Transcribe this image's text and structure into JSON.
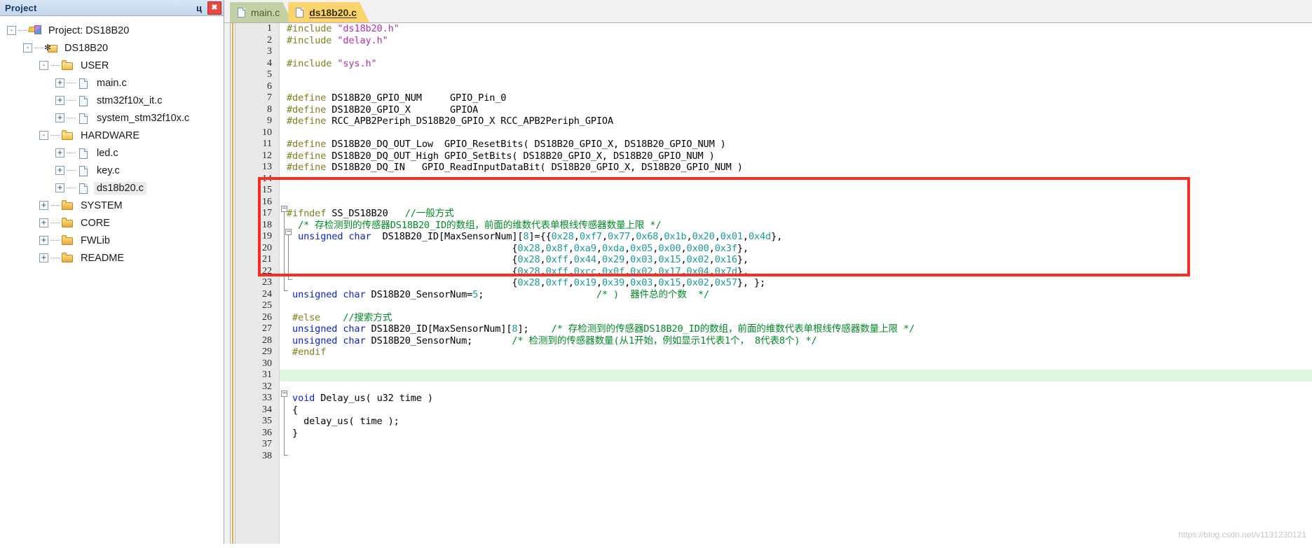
{
  "panel": {
    "title": "Project",
    "pin_icon": "pushpin-icon",
    "pin_glyph": "ц",
    "close_glyph": "✖",
    "tree": [
      {
        "label": "Project: DS18B20",
        "depth": 0,
        "expander": "-",
        "icon": "project-icon",
        "selected": false
      },
      {
        "label": "DS18B20",
        "depth": 1,
        "expander": "-",
        "icon": "target-icon",
        "selected": false
      },
      {
        "label": "USER",
        "depth": 2,
        "expander": "-",
        "icon": "folder-open-icon",
        "selected": false
      },
      {
        "label": "main.c",
        "depth": 3,
        "expander": "+",
        "icon": "file-icon",
        "selected": false
      },
      {
        "label": "stm32f10x_it.c",
        "depth": 3,
        "expander": "+",
        "icon": "file-icon",
        "selected": false
      },
      {
        "label": "system_stm32f10x.c",
        "depth": 3,
        "expander": "+",
        "icon": "file-icon",
        "selected": false
      },
      {
        "label": "HARDWARE",
        "depth": 2,
        "expander": "-",
        "icon": "folder-open-icon",
        "selected": false
      },
      {
        "label": "led.c",
        "depth": 3,
        "expander": "+",
        "icon": "file-icon",
        "selected": false
      },
      {
        "label": "key.c",
        "depth": 3,
        "expander": "+",
        "icon": "file-icon",
        "selected": false
      },
      {
        "label": "ds18b20.c",
        "depth": 3,
        "expander": "+",
        "icon": "file-icon",
        "selected": true
      },
      {
        "label": "SYSTEM",
        "depth": 2,
        "expander": "+",
        "icon": "folder-icon",
        "selected": false
      },
      {
        "label": "CORE",
        "depth": 2,
        "expander": "+",
        "icon": "folder-icon",
        "selected": false
      },
      {
        "label": "FWLib",
        "depth": 2,
        "expander": "+",
        "icon": "folder-icon",
        "selected": false
      },
      {
        "label": "README",
        "depth": 2,
        "expander": "+",
        "icon": "folder-icon",
        "selected": false
      }
    ]
  },
  "editor": {
    "tabs": [
      {
        "label": "main.c",
        "active": false
      },
      {
        "label": "ds18b20.c",
        "active": true
      }
    ],
    "first_line": 1,
    "last_line": 38,
    "highlight_line": 31,
    "lines": [
      {
        "n": 1,
        "spans": [
          {
            "t": "#include ",
            "c": "k-pre"
          },
          {
            "t": "\"ds18b20.h\"",
            "c": "k-str"
          }
        ]
      },
      {
        "n": 2,
        "spans": [
          {
            "t": "#include ",
            "c": "k-pre"
          },
          {
            "t": "\"delay.h\"",
            "c": "k-str"
          }
        ]
      },
      {
        "n": 3,
        "spans": []
      },
      {
        "n": 4,
        "spans": [
          {
            "t": "#include ",
            "c": "k-pre"
          },
          {
            "t": "\"sys.h\"",
            "c": "k-str"
          }
        ]
      },
      {
        "n": 5,
        "spans": []
      },
      {
        "n": 6,
        "spans": []
      },
      {
        "n": 7,
        "spans": [
          {
            "t": "#define ",
            "c": "k-pre"
          },
          {
            "t": "DS18B20_GPIO_NUM     GPIO_Pin_0",
            "c": "k-plain"
          }
        ]
      },
      {
        "n": 8,
        "spans": [
          {
            "t": "#define ",
            "c": "k-pre"
          },
          {
            "t": "DS18B20_GPIO_X       GPIOA",
            "c": "k-plain"
          }
        ]
      },
      {
        "n": 9,
        "spans": [
          {
            "t": "#define ",
            "c": "k-pre"
          },
          {
            "t": "RCC_APB2Periph_DS18B20_GPIO_X RCC_APB2Periph_GPIOA",
            "c": "k-plain"
          }
        ]
      },
      {
        "n": 10,
        "spans": []
      },
      {
        "n": 11,
        "spans": [
          {
            "t": "#define ",
            "c": "k-pre"
          },
          {
            "t": "DS18B20_DQ_OUT_Low  GPIO_ResetBits( DS18B20_GPIO_X, DS18B20_GPIO_NUM )",
            "c": "k-plain"
          }
        ]
      },
      {
        "n": 12,
        "spans": [
          {
            "t": "#define ",
            "c": "k-pre"
          },
          {
            "t": "DS18B20_DQ_OUT_High GPIO_SetBits( DS18B20_GPIO_X, DS18B20_GPIO_NUM )",
            "c": "k-plain"
          }
        ]
      },
      {
        "n": 13,
        "spans": [
          {
            "t": "#define ",
            "c": "k-pre"
          },
          {
            "t": "DS18B20_DQ_IN   GPIO_ReadInputDataBit( DS18B20_GPIO_X, DS18B20_GPIO_NUM )",
            "c": "k-plain"
          }
        ]
      },
      {
        "n": 14,
        "spans": []
      },
      {
        "n": 15,
        "spans": []
      },
      {
        "n": 16,
        "spans": []
      },
      {
        "n": 17,
        "spans": [
          {
            "t": "#ifndef ",
            "c": "k-pre"
          },
          {
            "t": "SS_DS18B20   ",
            "c": "k-plain"
          },
          {
            "t": "//一般方式",
            "c": "k-cmt"
          }
        ]
      },
      {
        "n": 18,
        "spans": [
          {
            "t": "  /* 存检测到的传感器DS18B20_ID的数组，前面的维数代表单根线传感器数量上限 */",
            "c": "k-cmt"
          }
        ]
      },
      {
        "n": 19,
        "spans": [
          {
            "t": "  ",
            "c": "k-plain"
          },
          {
            "t": "unsigned char",
            "c": "k-key"
          },
          {
            "t": "  DS18B20_ID[MaxSensorNum][",
            "c": "k-plain"
          },
          {
            "t": "8",
            "c": "k-num"
          },
          {
            "t": "]={{",
            "c": "k-plain"
          },
          {
            "t": "0x28",
            "c": "k-num"
          },
          {
            "t": ",",
            "c": "k-plain"
          },
          {
            "t": "0xf7",
            "c": "k-num"
          },
          {
            "t": ",",
            "c": "k-plain"
          },
          {
            "t": "0x77",
            "c": "k-num"
          },
          {
            "t": ",",
            "c": "k-plain"
          },
          {
            "t": "0x68",
            "c": "k-num"
          },
          {
            "t": ",",
            "c": "k-plain"
          },
          {
            "t": "0x1b",
            "c": "k-num"
          },
          {
            "t": ",",
            "c": "k-plain"
          },
          {
            "t": "0x20",
            "c": "k-num"
          },
          {
            "t": ",",
            "c": "k-plain"
          },
          {
            "t": "0x01",
            "c": "k-num"
          },
          {
            "t": ",",
            "c": "k-plain"
          },
          {
            "t": "0x4d",
            "c": "k-num"
          },
          {
            "t": "},",
            "c": "k-plain"
          }
        ]
      },
      {
        "n": 20,
        "spans": [
          {
            "t": "                                        {",
            "c": "k-plain"
          },
          {
            "t": "0x28",
            "c": "k-num"
          },
          {
            "t": ",",
            "c": "k-plain"
          },
          {
            "t": "0x8f",
            "c": "k-num"
          },
          {
            "t": ",",
            "c": "k-plain"
          },
          {
            "t": "0xa9",
            "c": "k-num"
          },
          {
            "t": ",",
            "c": "k-plain"
          },
          {
            "t": "0xda",
            "c": "k-num"
          },
          {
            "t": ",",
            "c": "k-plain"
          },
          {
            "t": "0x05",
            "c": "k-num"
          },
          {
            "t": ",",
            "c": "k-plain"
          },
          {
            "t": "0x00",
            "c": "k-num"
          },
          {
            "t": ",",
            "c": "k-plain"
          },
          {
            "t": "0x00",
            "c": "k-num"
          },
          {
            "t": ",",
            "c": "k-plain"
          },
          {
            "t": "0x3f",
            "c": "k-num"
          },
          {
            "t": "},",
            "c": "k-plain"
          }
        ]
      },
      {
        "n": 21,
        "spans": [
          {
            "t": "                                        {",
            "c": "k-plain"
          },
          {
            "t": "0x28",
            "c": "k-num"
          },
          {
            "t": ",",
            "c": "k-plain"
          },
          {
            "t": "0xff",
            "c": "k-num"
          },
          {
            "t": ",",
            "c": "k-plain"
          },
          {
            "t": "0x44",
            "c": "k-num"
          },
          {
            "t": ",",
            "c": "k-plain"
          },
          {
            "t": "0x29",
            "c": "k-num"
          },
          {
            "t": ",",
            "c": "k-plain"
          },
          {
            "t": "0x03",
            "c": "k-num"
          },
          {
            "t": ",",
            "c": "k-plain"
          },
          {
            "t": "0x15",
            "c": "k-num"
          },
          {
            "t": ",",
            "c": "k-plain"
          },
          {
            "t": "0x02",
            "c": "k-num"
          },
          {
            "t": ",",
            "c": "k-plain"
          },
          {
            "t": "0x16",
            "c": "k-num"
          },
          {
            "t": "},",
            "c": "k-plain"
          }
        ]
      },
      {
        "n": 22,
        "spans": [
          {
            "t": "                                        {",
            "c": "k-plain"
          },
          {
            "t": "0x28",
            "c": "k-num"
          },
          {
            "t": ",",
            "c": "k-plain"
          },
          {
            "t": "0xff",
            "c": "k-num"
          },
          {
            "t": ",",
            "c": "k-plain"
          },
          {
            "t": "0xcc",
            "c": "k-num"
          },
          {
            "t": ",",
            "c": "k-plain"
          },
          {
            "t": "0x0f",
            "c": "k-num"
          },
          {
            "t": ",",
            "c": "k-plain"
          },
          {
            "t": "0x02",
            "c": "k-num"
          },
          {
            "t": ",",
            "c": "k-plain"
          },
          {
            "t": "0x17",
            "c": "k-num"
          },
          {
            "t": ",",
            "c": "k-plain"
          },
          {
            "t": "0x04",
            "c": "k-num"
          },
          {
            "t": ",",
            "c": "k-plain"
          },
          {
            "t": "0x7d",
            "c": "k-num"
          },
          {
            "t": "},",
            "c": "k-plain"
          }
        ]
      },
      {
        "n": 23,
        "spans": [
          {
            "t": "                                        {",
            "c": "k-plain"
          },
          {
            "t": "0x28",
            "c": "k-num"
          },
          {
            "t": ",",
            "c": "k-plain"
          },
          {
            "t": "0xff",
            "c": "k-num"
          },
          {
            "t": ",",
            "c": "k-plain"
          },
          {
            "t": "0x19",
            "c": "k-num"
          },
          {
            "t": ",",
            "c": "k-plain"
          },
          {
            "t": "0x39",
            "c": "k-num"
          },
          {
            "t": ",",
            "c": "k-plain"
          },
          {
            "t": "0x03",
            "c": "k-num"
          },
          {
            "t": ",",
            "c": "k-plain"
          },
          {
            "t": "0x15",
            "c": "k-num"
          },
          {
            "t": ",",
            "c": "k-plain"
          },
          {
            "t": "0x02",
            "c": "k-num"
          },
          {
            "t": ",",
            "c": "k-plain"
          },
          {
            "t": "0x57",
            "c": "k-num"
          },
          {
            "t": "}, };",
            "c": "k-plain"
          }
        ]
      },
      {
        "n": 24,
        "spans": [
          {
            "t": " ",
            "c": "k-plain"
          },
          {
            "t": "unsigned char",
            "c": "k-key"
          },
          {
            "t": " DS18B20_SensorNum=",
            "c": "k-plain"
          },
          {
            "t": "5",
            "c": "k-num"
          },
          {
            "t": ";                    ",
            "c": "k-plain"
          },
          {
            "t": "/* )  器件总的个数  */",
            "c": "k-cmt"
          }
        ]
      },
      {
        "n": 25,
        "spans": []
      },
      {
        "n": 26,
        "spans": [
          {
            "t": " ",
            "c": "k-plain"
          },
          {
            "t": "#else",
            "c": "k-pre"
          },
          {
            "t": "    ",
            "c": "k-plain"
          },
          {
            "t": "//搜索方式",
            "c": "k-cmt"
          }
        ]
      },
      {
        "n": 27,
        "spans": [
          {
            "t": " ",
            "c": "k-plain"
          },
          {
            "t": "unsigned char",
            "c": "k-key"
          },
          {
            "t": " DS18B20_ID[MaxSensorNum][",
            "c": "k-plain"
          },
          {
            "t": "8",
            "c": "k-num"
          },
          {
            "t": "];    ",
            "c": "k-plain"
          },
          {
            "t": "/* 存检测到的传感器DS18B20_ID的数组，前面的维数代表单根线传感器数量上限 */",
            "c": "k-cmt"
          }
        ]
      },
      {
        "n": 28,
        "spans": [
          {
            "t": " ",
            "c": "k-plain"
          },
          {
            "t": "unsigned char",
            "c": "k-key"
          },
          {
            "t": " DS18B20_SensorNum;       ",
            "c": "k-plain"
          },
          {
            "t": "/* 检测到的传感器数量(从1开始，例如显示1代表1个， 8代表8个) */",
            "c": "k-cmt"
          }
        ]
      },
      {
        "n": 29,
        "spans": [
          {
            "t": " ",
            "c": "k-plain"
          },
          {
            "t": "#endif",
            "c": "k-pre"
          }
        ]
      },
      {
        "n": 30,
        "spans": []
      },
      {
        "n": 31,
        "spans": []
      },
      {
        "n": 32,
        "spans": []
      },
      {
        "n": 33,
        "spans": [
          {
            "t": " ",
            "c": "k-plain"
          },
          {
            "t": "void",
            "c": "k-key"
          },
          {
            "t": " Delay_us( u32 time )",
            "c": "k-plain"
          }
        ]
      },
      {
        "n": 34,
        "spans": [
          {
            "t": " {",
            "c": "k-plain"
          }
        ]
      },
      {
        "n": 35,
        "spans": [
          {
            "t": "   delay_us( time );",
            "c": "k-plain"
          }
        ]
      },
      {
        "n": 36,
        "spans": [
          {
            "t": " }",
            "c": "k-plain"
          }
        ]
      },
      {
        "n": 37,
        "spans": []
      },
      {
        "n": 38,
        "spans": []
      }
    ],
    "annotation": {
      "name": "red-highlight-box",
      "color": "#fb2c22"
    }
  },
  "watermark": "https://blog.csdn.net/v1131230121"
}
